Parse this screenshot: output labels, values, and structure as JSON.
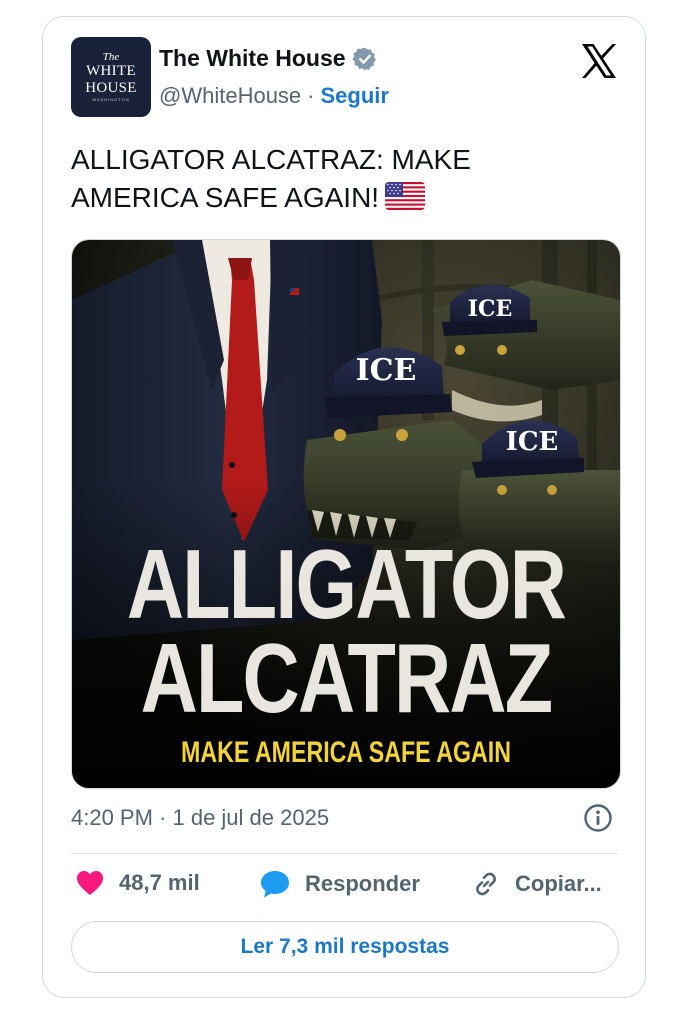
{
  "author": {
    "display_name": "The White House",
    "handle": "@WhiteHouse",
    "separator": "·",
    "follow_label": "Seguir",
    "avatar_text": {
      "line1": "The",
      "line2": "WHITE",
      "line3": "HOUSE",
      "line4": "WASHINGTON"
    }
  },
  "tweet": {
    "text": "ALLIGATOR ALCATRAZ: MAKE AMERICA SAFE AGAIN!",
    "timestamp": "4:20 PM · 1 de jul de 2025"
  },
  "media": {
    "headline_line1": "ALLIGATOR",
    "headline_line2": "ALCATRAZ",
    "tagline": "MAKE AMERICA SAFE AGAIN",
    "cap_text_1": "ICE",
    "cap_text_2": "ICE",
    "cap_text_3": "ICE"
  },
  "actions": {
    "likes": "48,7 mil",
    "reply_label": "Responder",
    "copy_label": "Copiar..."
  },
  "replies_button_label": "Ler 7,3 mil respostas",
  "colors": {
    "accent": "#1d78c8",
    "like": "#f91880",
    "reply": "#1d9bf0",
    "muted": "#536471",
    "verified_badge": "#829aab",
    "tagline": "#f2d33a"
  }
}
